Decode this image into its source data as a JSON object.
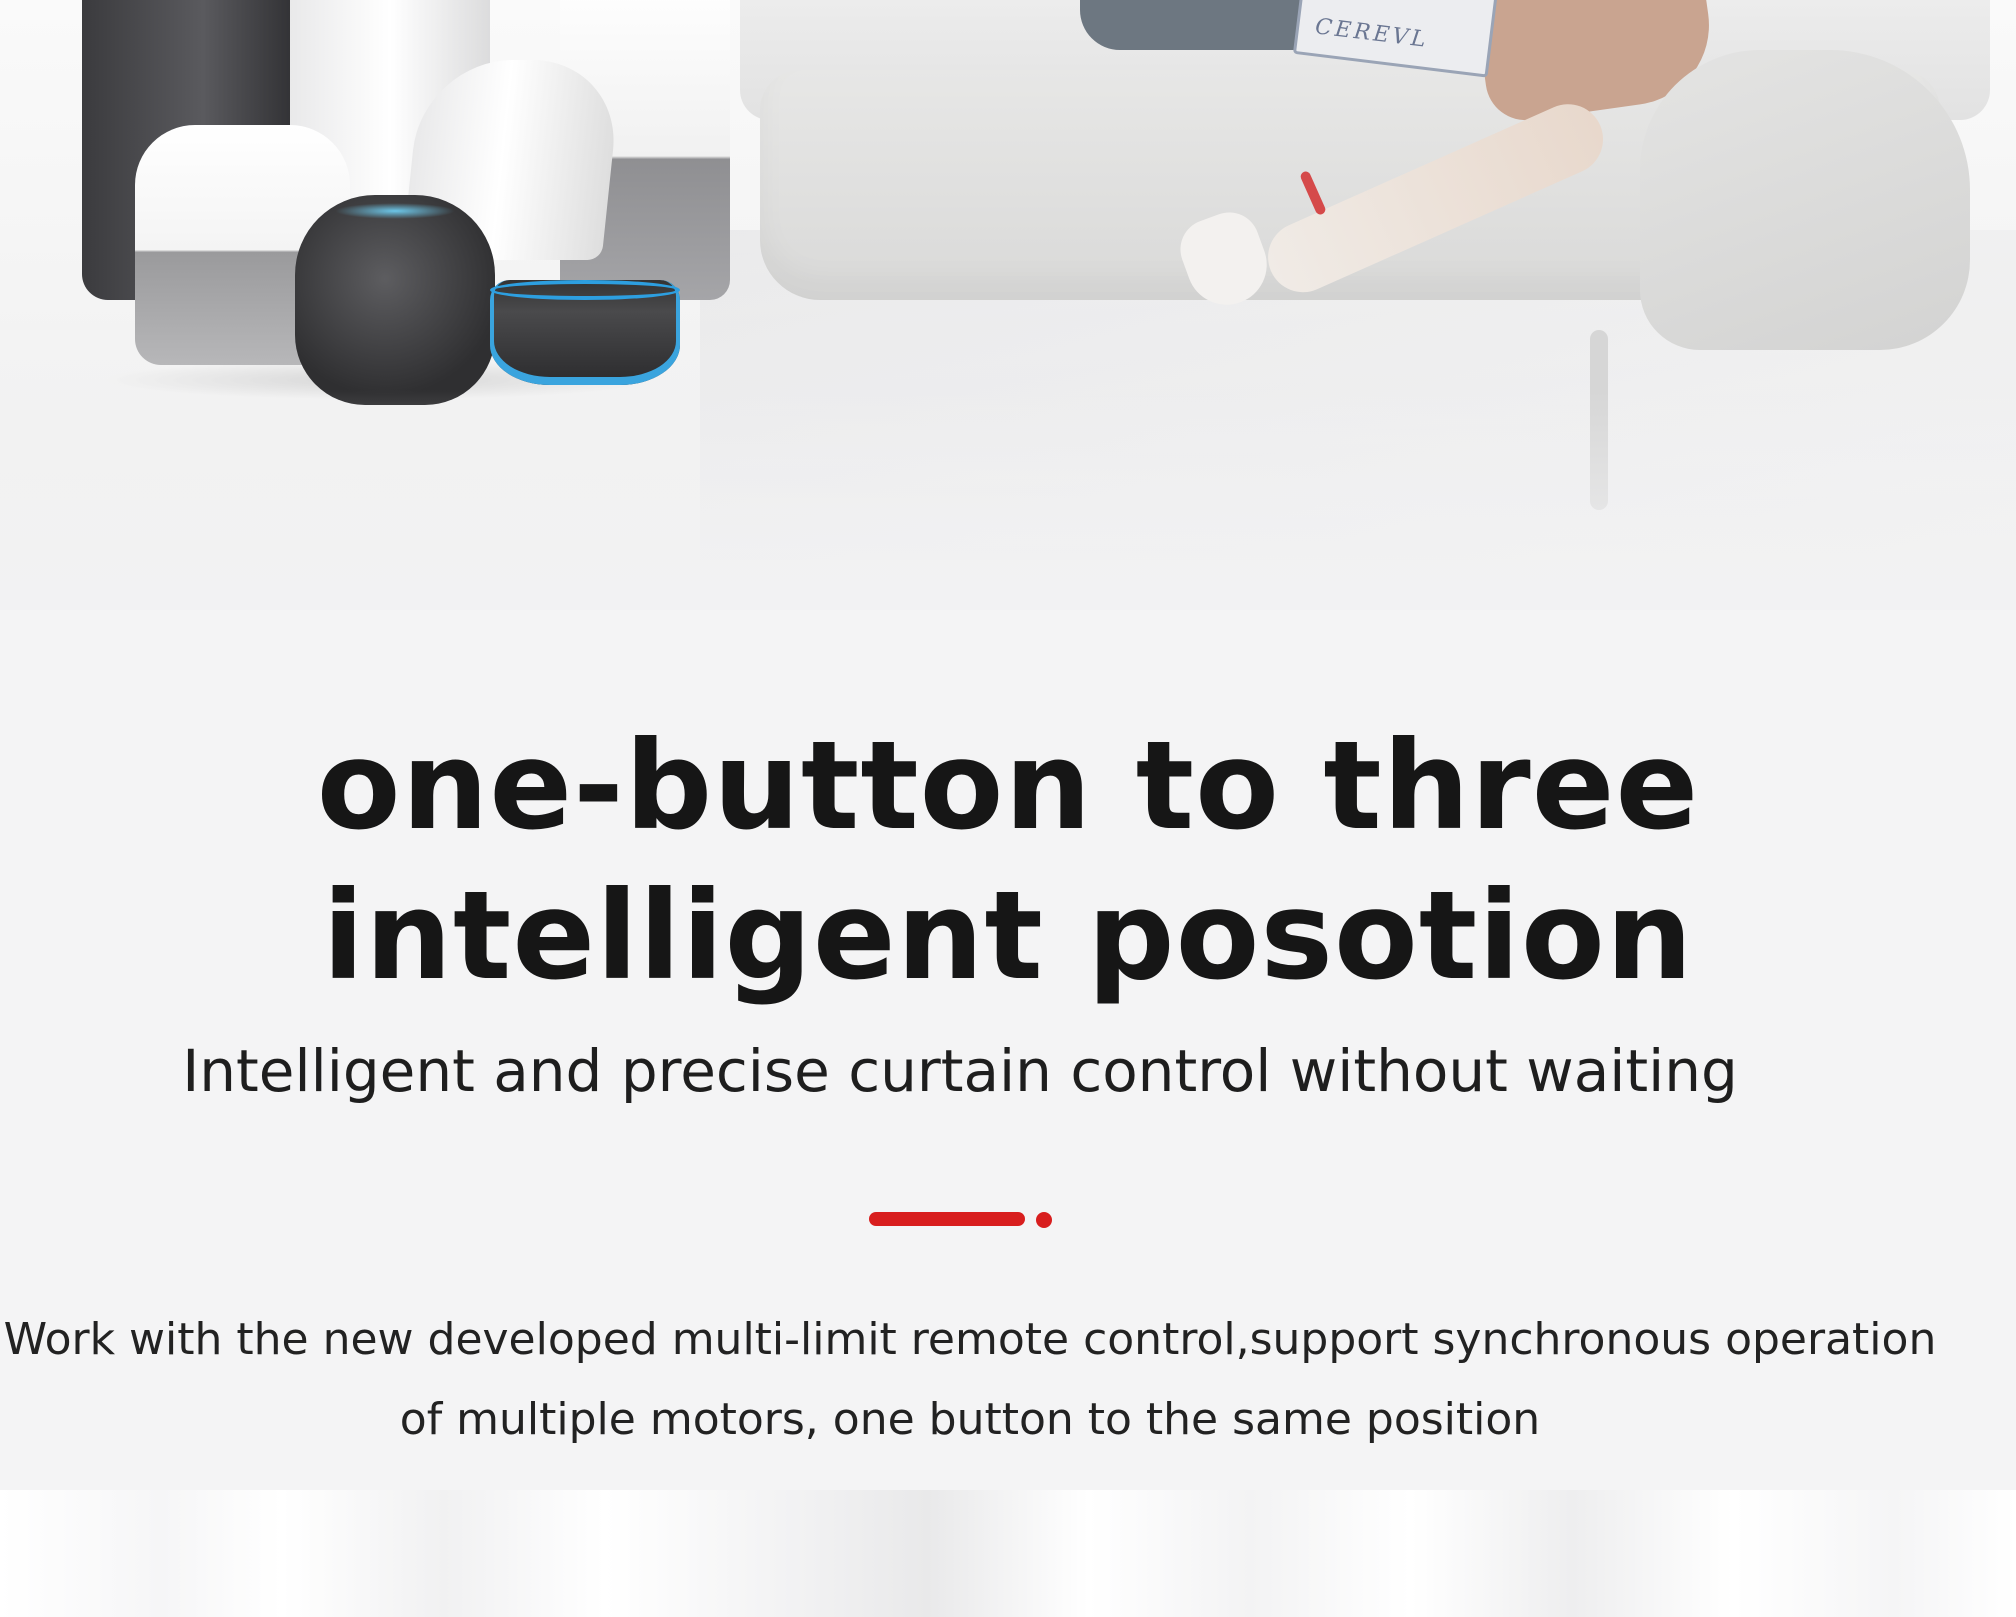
{
  "hero": {
    "book_text": "CEREVL"
  },
  "content": {
    "headline_line1": "one-button to three",
    "headline_line2": "intelligent posotion",
    "subtitle": "Intelligent and precise curtain control without waiting",
    "body_line1": "Work with the new developed multi-limit remote control,support synchronous operation",
    "body_line2": "of multiple motors, one button to the same position"
  },
  "colors": {
    "accent": "#d81e1e",
    "headline": "#161616",
    "background": "#f4f4f5"
  }
}
